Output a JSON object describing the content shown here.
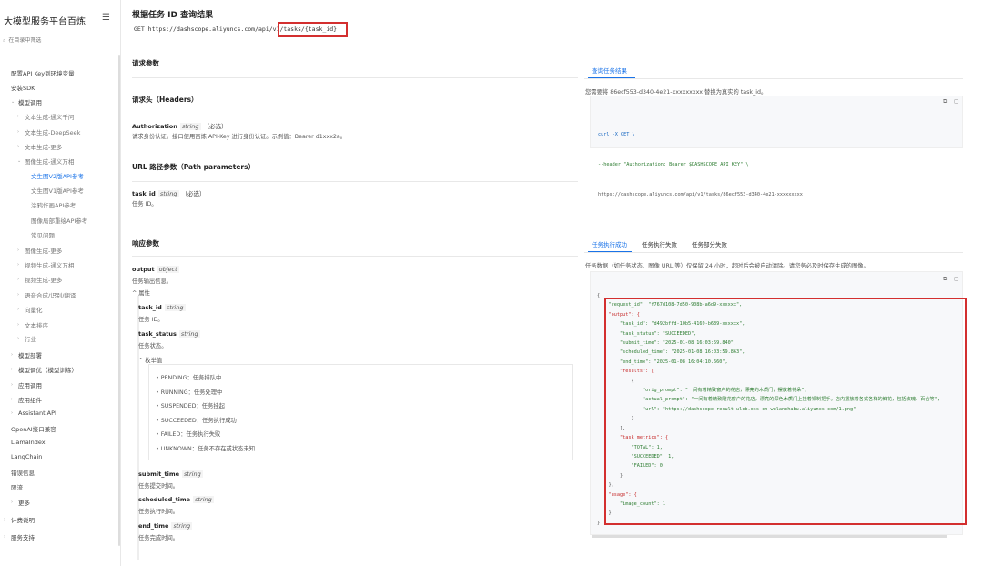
{
  "sidebar": {
    "brand": "大模型服务平台百炼",
    "search_placeholder": "在目录中筛选",
    "items": [
      {
        "label": "配置API Key到环境变量",
        "level": 1
      },
      {
        "label": "安装SDK",
        "level": 1
      },
      {
        "label": "模型调用",
        "level": 1,
        "expanded": true
      },
      {
        "label": "文本生成-通义千问",
        "level": 2
      },
      {
        "label": "文本生成-DeepSeek",
        "level": 2
      },
      {
        "label": "文本生成-更多",
        "level": 2
      },
      {
        "label": "图像生成-通义万相",
        "level": 2,
        "expanded": true
      },
      {
        "label": "文生图V2版API参考",
        "level": 3,
        "active": true
      },
      {
        "label": "文生图V1版API参考",
        "level": 3
      },
      {
        "label": "涂鸦作画API参考",
        "level": 3
      },
      {
        "label": "图像局部重绘API参考",
        "level": 3
      },
      {
        "label": "常见问题",
        "level": 3
      },
      {
        "label": "图像生成-更多",
        "level": 2
      },
      {
        "label": "视频生成-通义万相",
        "level": 2
      },
      {
        "label": "视频生成-更多",
        "level": 2
      },
      {
        "label": "语音合成/识别/翻译",
        "level": 2
      },
      {
        "label": "向量化",
        "level": 2
      },
      {
        "label": "文本排序",
        "level": 2
      },
      {
        "label": "行业",
        "level": 2
      },
      {
        "label": "模型部署",
        "level": 1
      },
      {
        "label": "模型调优（模型训练）",
        "level": 1
      },
      {
        "label": "应用调用",
        "level": 1
      },
      {
        "label": "应用组件",
        "level": 1
      },
      {
        "label": "Assistant API",
        "level": 1
      },
      {
        "label": "OpenAI接口兼容",
        "level": 1
      },
      {
        "label": "LlamaIndex",
        "level": 1
      },
      {
        "label": "LangChain",
        "level": 1
      },
      {
        "label": "错误信息",
        "level": 1
      },
      {
        "label": "限流",
        "level": 1
      },
      {
        "label": "更多",
        "level": 1
      },
      {
        "label": "计费说明",
        "level": 0
      },
      {
        "label": "服务支持",
        "level": 0
      }
    ]
  },
  "main": {
    "title": "根据任务 ID 查询结果",
    "get_line": "GET https://dashscope.aliyuncs.com/api/v1/tasks/{task_id}",
    "request_params_heading": "请求参数",
    "headers_heading": "请求头（Headers）",
    "auth": {
      "name": "Authorization",
      "type": "string",
      "req": "（必选）",
      "desc": "请求身份认证。接口使用百炼 API-Key 进行身份认证。示例值：Bearer d1xxx2a。"
    },
    "path_heading": "URL 路径参数（Path parameters）",
    "task_id_param": {
      "name": "task_id",
      "type": "string",
      "req": "（必选）",
      "desc": "任务 ID。"
    },
    "response_heading": "响应参数",
    "output": {
      "name": "output",
      "type": "object",
      "desc": "任务输出信息。",
      "toggle": "属性"
    },
    "task_id_field": {
      "name": "task_id",
      "type": "string",
      "desc": "任务 ID。"
    },
    "task_status": {
      "name": "task_status",
      "type": "string",
      "desc": "任务状态。",
      "enum_toggle": "枚举值"
    },
    "enums": [
      "PENDING：任务排队中",
      "RUNNING：任务处理中",
      "SUSPENDED：任务挂起",
      "SUCCEEDED：任务执行成功",
      "FAILED：任务执行失败",
      "UNKNOWN：任务不存在或状态未知"
    ],
    "submit_time": {
      "name": "submit_time",
      "type": "string",
      "desc": "任务提交时间。"
    },
    "scheduled_time": {
      "name": "scheduled_time",
      "type": "string",
      "desc": "任务执行时间。"
    },
    "end_time": {
      "name": "end_time",
      "type": "string",
      "desc": "任务完成时间。"
    }
  },
  "right": {
    "tab_query": "查询任务结果",
    "query_note": "您需要将 86ecf553-d340-4e21-xxxxxxxxx 替换为真实的 task_id。",
    "curl_lines": [
      "curl -X GET \\",
      "--header \"Authorization: Bearer $DASHSCOPE_API_KEY\" \\",
      "https://dashscope.aliyuncs.com/api/v1/tasks/86ecf553-d340-4e21-xxxxxxxxx"
    ],
    "resp_tabs": [
      "任务执行成功",
      "任务执行失败",
      "任务部分失败"
    ],
    "resp_note": "任务数据（如任务状态、图像 URL 等）仅保留 24 小时，超时后会被自动清除。请您务必及时保存生成的图像。",
    "json_lines": [
      "{",
      "    \"request_id\": \"f767d108-7d50-908b-a6d9-xxxxxx\",",
      "    \"output\": {",
      "        \"task_id\": \"d492bffd-10b5-4169-b639-xxxxxx\",",
      "        \"task_status\": \"SUCCEEDED\",",
      "        \"submit_time\": \"2025-01-08 16:03:59.840\",",
      "        \"scheduled_time\": \"2025-01-08 16:03:59.863\",",
      "        \"end_time\": \"2025-01-08 16:04:10.660\",",
      "        \"results\": [",
      "            {",
      "                \"orig_prompt\": \"一间有着精致窗户的花店，漂亮的木质门，摆放着花朵\",",
      "                \"actual_prompt\": \"一间有着精致雕花窗户的花店，漂亮的深色木质门上挂着铜制把手。店内摆放着各式各样的鲜花，包括玫瑰、百合等\",",
      "                \"url\": \"https://dashscope-result-wlcb.oss-cn-wulanchabu.aliyuncs.com/1.png\"",
      "            }",
      "        ],",
      "        \"task_metrics\": {",
      "            \"TOTAL\": 1,",
      "            \"SUCCEEDED\": 1,",
      "            \"FAILED\": 0",
      "        }",
      "    },",
      "    \"usage\": {",
      "        \"image_count\": 1",
      "    }",
      "}"
    ]
  },
  "colors": {
    "accent": "#1a73e8",
    "highlight_box": "#d32f2f",
    "string": "#2e7d32",
    "key": "#c62828"
  }
}
